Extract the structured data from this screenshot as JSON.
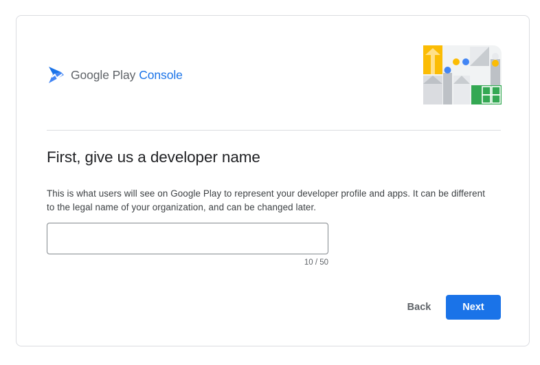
{
  "brand": {
    "google_play": "Google Play",
    "console": "Console",
    "logo_icon": "google-play-console-logo-icon",
    "accent_color": "#1a73e8"
  },
  "header": {
    "illustration_icon": "developer-illustration",
    "illustration_colors": [
      "#fbbc04",
      "#4285f4",
      "#34a853",
      "#dadce0"
    ]
  },
  "page": {
    "title": "First, give us a developer name",
    "description": "This is what users will see on Google Play to represent your developer profile and apps. It can be different to the legal name of your organization, and can be changed later."
  },
  "form": {
    "developer_name": {
      "value": "",
      "placeholder": "",
      "counter": "10 / 50"
    }
  },
  "actions": {
    "back_label": "Back",
    "next_label": "Next",
    "primary_color": "#1a73e8"
  }
}
